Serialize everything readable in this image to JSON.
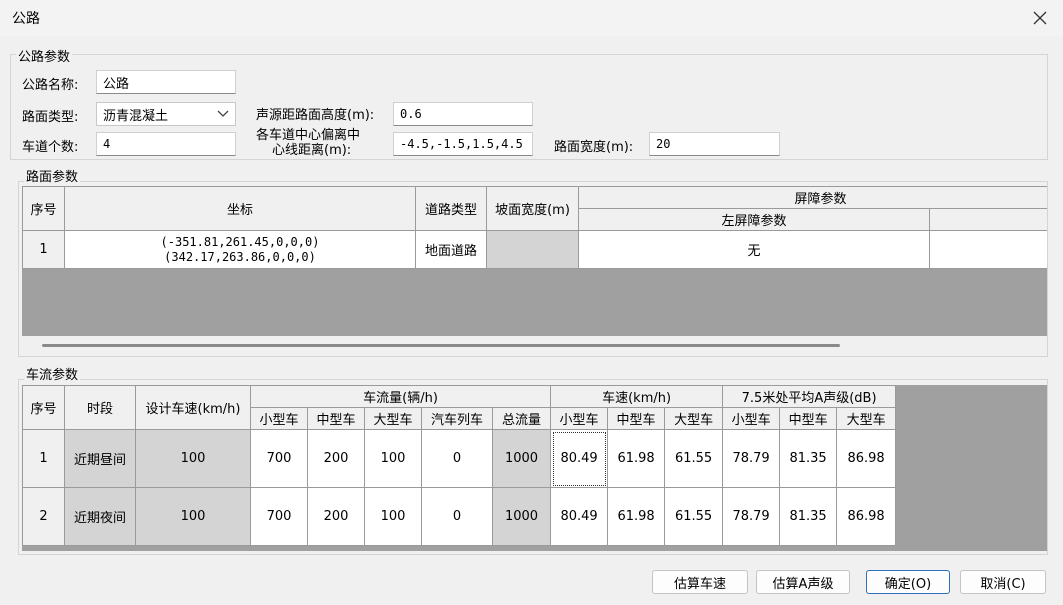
{
  "window": {
    "title": "公路"
  },
  "road_params": {
    "group_title": "公路参数",
    "name_label": "公路名称:",
    "name_value": "公路",
    "surface_label": "路面类型:",
    "surface_value": "沥青混凝土",
    "lanes_label": "车道个数:",
    "lanes_value": "4",
    "source_height_label": "声源距路面高度(m):",
    "source_height_value": "0.6",
    "lane_offset_label_1": "各车道中心偏离中",
    "lane_offset_label_2": "心线距离(m):",
    "lane_offset_value": "-4.5,-1.5,1.5,4.5",
    "width_label": "路面宽度(m):",
    "width_value": "20"
  },
  "surface_table": {
    "group_title": "路面参数",
    "headers": {
      "index": "序号",
      "coords": "坐标",
      "road_type": "道路类型",
      "slope_width": "坡面宽度(m)",
      "barrier": "屏障参数",
      "left_barrier": "左屏障参数"
    },
    "rows": [
      {
        "index": "1",
        "coord_1": "(-351.81,261.45,0,0,0)",
        "coord_2": "(342.17,263.86,0,0,0)",
        "road_type": "地面道路",
        "left_barrier": "无"
      }
    ]
  },
  "traffic_table": {
    "group_title": "车流参数",
    "headers": {
      "index": "序号",
      "period": "时段",
      "design_speed": "设计车速(km/h)",
      "flow": "车流量(辆/h)",
      "speed": "车速(km/h)",
      "noise": "7.5米处平均A声级(dB)",
      "small": "小型车",
      "medium": "中型车",
      "large": "大型车",
      "train": "汽车列车",
      "total": "总流量"
    },
    "rows": [
      {
        "index": "1",
        "period": "近期昼间",
        "design_speed": "100",
        "small": "700",
        "medium": "200",
        "large": "100",
        "train": "0",
        "total": "1000",
        "spd_small": "80.49",
        "spd_medium": "61.98",
        "spd_large": "61.55",
        "db_small": "78.79",
        "db_medium": "81.35",
        "db_large": "86.98"
      },
      {
        "index": "2",
        "period": "近期夜间",
        "design_speed": "100",
        "small": "700",
        "medium": "200",
        "large": "100",
        "train": "0",
        "total": "1000",
        "spd_small": "80.49",
        "spd_medium": "61.98",
        "spd_large": "61.55",
        "db_small": "78.79",
        "db_medium": "81.35",
        "db_large": "86.98"
      }
    ]
  },
  "buttons": {
    "estimate_speed": "估算车速",
    "estimate_level": "估算A声级",
    "ok": "确定(O)",
    "cancel": "取消(C)"
  }
}
